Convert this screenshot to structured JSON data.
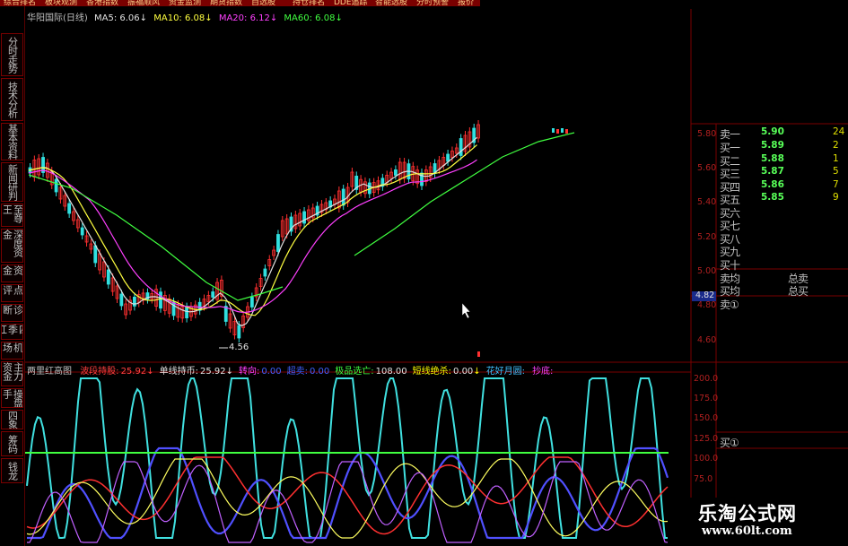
{
  "menu": [
    "综合排名",
    "板块观测",
    "香港指数",
    "振福顺风",
    "资金监测",
    "期货指数",
    "自选股",
    "持仓排名",
    "DDE追踪",
    "智能选股",
    "分时预警",
    "报价"
  ],
  "sidebar_tabs": [
    "分时走势",
    "技术分析",
    "基本资料",
    "新闻研判",
    "至尊王",
    "深度资金",
    "资金",
    "点评",
    "诊断",
    "四季红",
    "机场",
    "主力资金",
    "操盘手",
    "四象",
    "筹码",
    "钱龙"
  ],
  "main_legend": {
    "title": "华阳国际(日线)",
    "ma5": "MA5: 6.06",
    "ma10": "MA10: 6.08",
    "ma20": "MA20: 6.12",
    "ma60": "MA60: 6.08",
    "arrow": "↓"
  },
  "sub_legend": {
    "title": "两里红高图",
    "items": [
      {
        "label": "波段持股:",
        "value": "25.92",
        "arrow": "↓",
        "color": "#ff4040",
        "vcolor": "#ff4040"
      },
      {
        "label": "单线持币:",
        "value": "25.92",
        "arrow": "↓",
        "color": "#e0e0e0",
        "vcolor": "#e0e0e0"
      },
      {
        "label": "转向:",
        "value": "0.00",
        "arrow": "",
        "color": "#ff40ff",
        "vcolor": "#4060ff"
      },
      {
        "label": "超卖:",
        "value": "0.00",
        "arrow": "",
        "color": "#4060ff",
        "vcolor": "#4060ff"
      },
      {
        "label": "极品选亡:",
        "value": "108.00",
        "arrow": "",
        "color": "#40ff40",
        "vcolor": "#e0e0e0"
      },
      {
        "label": "短线绝杀:",
        "value": "0.00",
        "arrow": "↓",
        "color": "#ffff00",
        "vcolor": "#e0e0e0"
      },
      {
        "label": "花好月圆:",
        "value": "",
        "arrow": "",
        "color": "#40c0ff",
        "vcolor": "#e0e0e0"
      },
      {
        "label": "抄底:",
        "value": "",
        "arrow": "",
        "color": "#ff40ff",
        "vcolor": "#e0e0e0"
      }
    ]
  },
  "price_axis": [
    "5.80",
    "5.60",
    "5.40",
    "5.20",
    "5.00",
    "4.80",
    "4.60"
  ],
  "current_price_tag": "4.82",
  "low_marker": "4.56",
  "sub_axis": [
    "200.0",
    "175.0",
    "150.0",
    "125.0",
    "100.0",
    "75.0"
  ],
  "quote": {
    "sell1": {
      "label": "卖一",
      "price": "5.90",
      "vol": "24"
    },
    "buys": [
      {
        "label": "买一",
        "price": "5.89",
        "vol": "2"
      },
      {
        "label": "买二",
        "price": "5.88",
        "vol": "1"
      },
      {
        "label": "买三",
        "price": "5.87",
        "vol": "5"
      },
      {
        "label": "买四",
        "price": "5.86",
        "vol": "7"
      },
      {
        "label": "买五",
        "price": "5.85",
        "vol": "9"
      },
      {
        "label": "买六",
        "price": "",
        "vol": ""
      },
      {
        "label": "买七",
        "price": "",
        "vol": ""
      },
      {
        "label": "买八",
        "price": "",
        "vol": ""
      },
      {
        "label": "买九",
        "price": "",
        "vol": ""
      },
      {
        "label": "买十",
        "price": "",
        "vol": ""
      }
    ],
    "sell_avg": "卖均",
    "buy_avg": "买均",
    "total_sell": "总卖",
    "total_buy": "总买",
    "sell_circle": "卖①",
    "buy_circle": "买①"
  },
  "watermark": {
    "title": "乐淘公式网",
    "url": "www.60lt.com"
  },
  "colors": {
    "up": "#ff3030",
    "down": "#30e0e0",
    "ma5": "#e0e0e0",
    "ma10": "#ffff40",
    "ma20": "#ff40ff",
    "ma60": "#40ff40",
    "grid": "#7a0000"
  }
}
